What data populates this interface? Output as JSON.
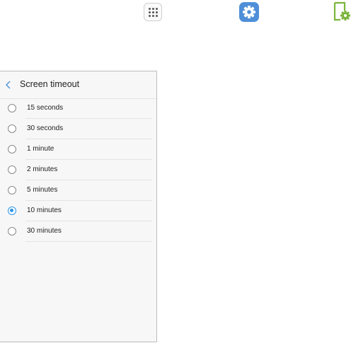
{
  "icons": {
    "apps": "apps-grid-icon",
    "settings": "settings-gear-icon",
    "display": "display-settings-icon"
  },
  "colors": {
    "settings_icon": "#4f8fd8",
    "display_icon": "#7bb43a",
    "radio_selected": "#2b96e8"
  },
  "screen": {
    "title": "Screen timeout",
    "back_icon": "chevron-left-icon",
    "options": [
      {
        "label": "15 seconds",
        "selected": false
      },
      {
        "label": "30 seconds",
        "selected": false
      },
      {
        "label": "1 minute",
        "selected": false
      },
      {
        "label": "2 minutes",
        "selected": false
      },
      {
        "label": "5 minutes",
        "selected": false
      },
      {
        "label": "10 minutes",
        "selected": true
      },
      {
        "label": "30 minutes",
        "selected": false
      }
    ]
  }
}
